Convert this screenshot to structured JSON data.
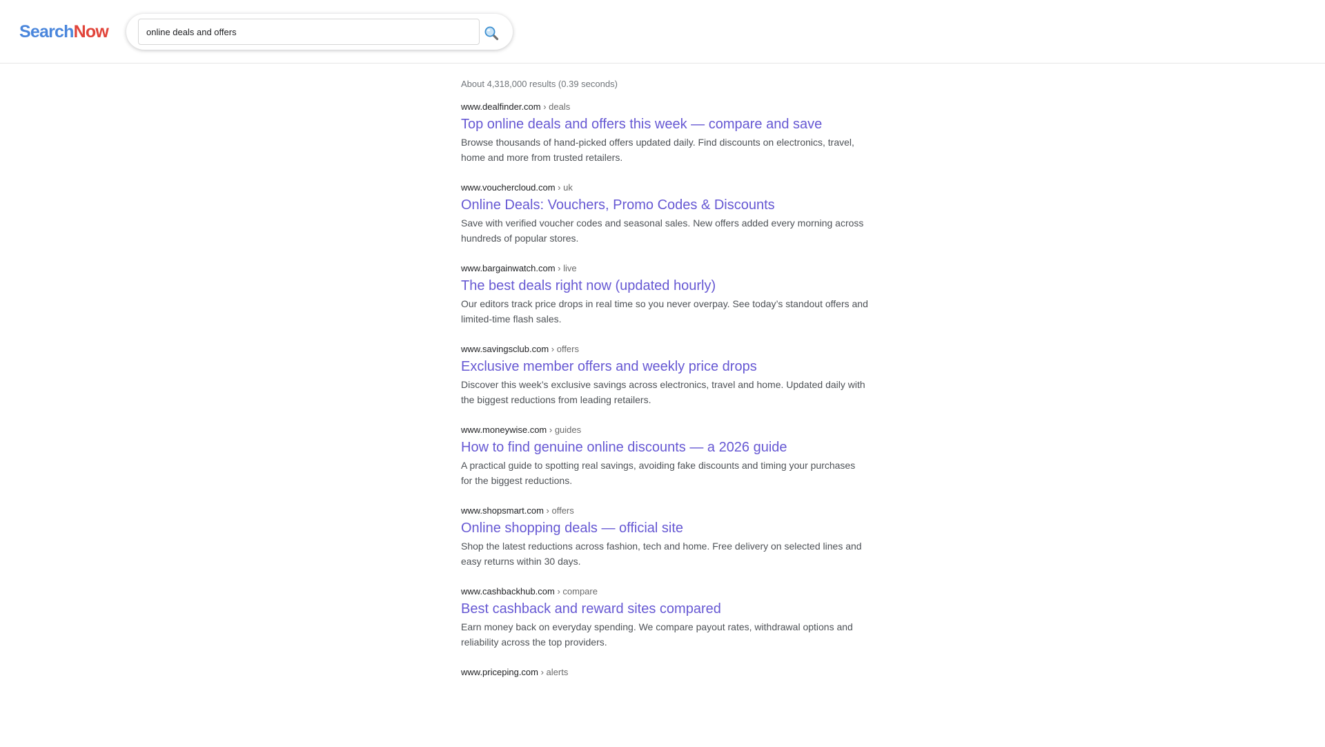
{
  "brand": {
    "part1": "Search",
    "part2": "Now",
    "color1": "#4a86dc",
    "color2": "#e1443a"
  },
  "search": {
    "query": "online deals and offers",
    "button_icon": "magnifier-icon"
  },
  "stats": "About 4,318,000 results (0.39 seconds)",
  "link_color": "#6658d3",
  "results": [
    {
      "domain": "www.dealfinder.com",
      "crumb": " › deals",
      "title": "Top online deals and offers this week — compare and save",
      "snippet": "Browse thousands of hand-picked offers updated daily. Find discounts on electronics, travel, home and more from trusted retailers."
    },
    {
      "domain": "www.vouchercloud.com",
      "crumb": " › uk",
      "title": "Online Deals: Vouchers, Promo Codes & Discounts",
      "snippet": "Save with verified voucher codes and seasonal sales. New offers added every morning across hundreds of popular stores."
    },
    {
      "domain": "www.bargainwatch.com",
      "crumb": " › live",
      "title": "The best deals right now (updated hourly)",
      "snippet": "Our editors track price drops in real time so you never overpay. See today’s standout offers and limited-time flash sales."
    },
    {
      "domain": "www.savingsclub.com",
      "crumb": " › offers",
      "title": "Exclusive member offers and weekly price drops",
      "snippet": "Discover this week’s exclusive savings across electronics, travel and home. Updated daily with the biggest reductions from leading retailers."
    },
    {
      "domain": "www.moneywise.com",
      "crumb": " › guides",
      "title": "How to find genuine online discounts — a 2026 guide",
      "snippet": "A practical guide to spotting real savings, avoiding fake discounts and timing your purchases for the biggest reductions."
    },
    {
      "domain": "www.shopsmart.com",
      "crumb": " › offers",
      "title": "Online shopping deals — official site",
      "snippet": "Shop the latest reductions across fashion, tech and home. Free delivery on selected lines and easy returns within 30 days."
    },
    {
      "domain": "www.cashbackhub.com",
      "crumb": " › compare",
      "title": "Best cashback and reward sites compared",
      "snippet": "Earn money back on everyday spending. We compare payout rates, withdrawal options and reliability across the top providers."
    },
    {
      "domain": "www.priceping.com",
      "crumb": " › alerts",
      "title": "",
      "snippet": ""
    }
  ]
}
